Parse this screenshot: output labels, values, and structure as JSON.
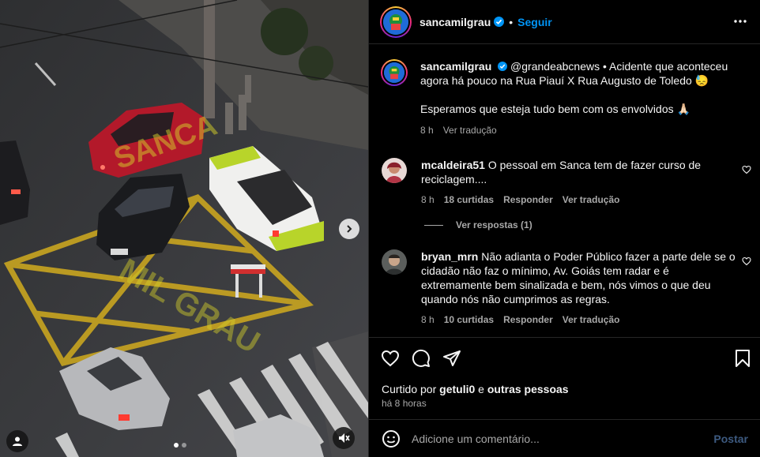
{
  "post": {
    "username": "sancamilgrau",
    "follow_label": "Seguir",
    "separator": "•",
    "caption_mention": "@grandeabcnews",
    "caption_text": " • Acidente que aconteceu agora há pouco na Rua Piauí X Rua Augusto de Toledo 😓",
    "caption_text2": "Esperamos que esteja tudo bem com os envolvidos 🙏🏻",
    "caption_time": "8 h",
    "caption_translate": "Ver tradução",
    "watermark_1": "SANCA",
    "watermark_2": "MIL GRAU"
  },
  "comments": [
    {
      "username": "mcaldeira51",
      "text": "O pessoal em Sanca tem de fazer curso de reciclagem....",
      "time": "8 h",
      "likes": "18 curtidas",
      "reply": "Responder",
      "translate": "Ver tradução",
      "view_replies": "Ver respostas (1)"
    },
    {
      "username": "bryan_mrn",
      "text": "Não adianta o Poder Público fazer a parte dele se o cidadão não faz o mínimo, Av. Goiás tem radar e é extremamente bem sinalizada e bem, nós vimos o que deu quando nós não cumprimos as regras.",
      "time": "8 h",
      "likes": "10 curtidas",
      "reply": "Responder",
      "translate": "Ver tradução"
    }
  ],
  "actions": {
    "liked_by_prefix": "Curtido por ",
    "liked_by_user": "getuli0",
    "liked_by_conj": " e ",
    "liked_by_others": "outras pessoas",
    "timestamp": "há 8 horas"
  },
  "add_comment": {
    "placeholder": "Adicione um comentário...",
    "post_label": "Postar"
  },
  "icons": {
    "heart": "heart-icon",
    "comment": "comment-icon",
    "share": "send-icon",
    "bookmark": "bookmark-icon",
    "emoji": "emoji-icon",
    "more": "more-horizontal-icon",
    "next": "chevron-right-icon",
    "mute": "speaker-muted-icon",
    "user_tag": "user-icon",
    "verified": "verified-badge-icon"
  },
  "colors": {
    "link": "#0095f6",
    "muted": "#a8a8a8",
    "verified": "#0095f6"
  },
  "carousel": {
    "current": 1,
    "total": 2
  }
}
